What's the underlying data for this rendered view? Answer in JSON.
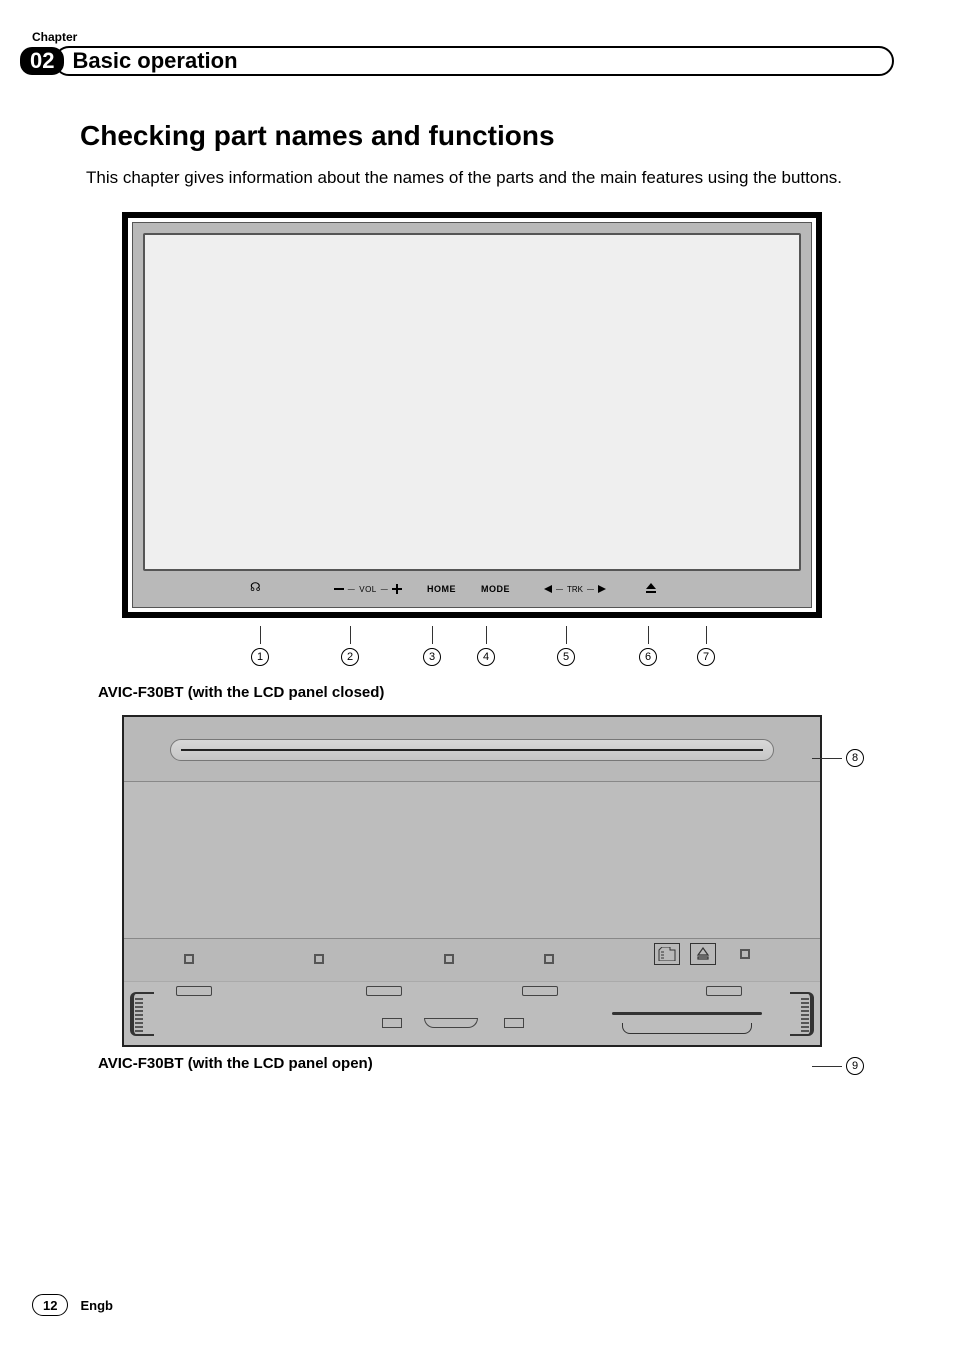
{
  "header": {
    "chapter_label": "Chapter",
    "chapter_number": "02",
    "chapter_title": "Basic operation"
  },
  "section": {
    "heading": "Checking part names and functions",
    "intro": "This chapter gives information about the names of the parts and the main features using the buttons."
  },
  "figure1": {
    "buttons": {
      "vol_label": "VOL",
      "home_label": "HOME",
      "mode_label": "MODE",
      "trk_label": "TRK"
    },
    "callouts": [
      "1",
      "2",
      "3",
      "4",
      "5",
      "6",
      "7"
    ],
    "caption": "AVIC-F30BT (with the LCD panel closed)"
  },
  "figure2": {
    "side_callouts": [
      "8",
      "9"
    ],
    "caption": "AVIC-F30BT (with the LCD panel open)"
  },
  "footer": {
    "page_number": "12",
    "language": "Engb"
  }
}
